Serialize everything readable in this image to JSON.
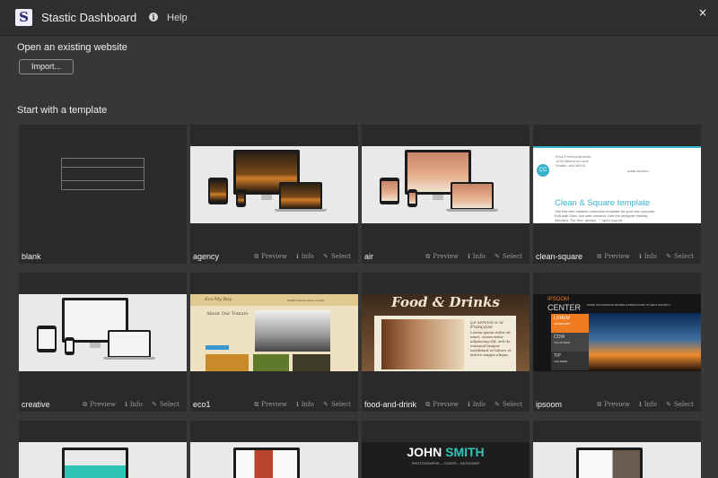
{
  "header": {
    "logo_letter": "S",
    "title": "Stastic Dashboard",
    "help_label": "Help",
    "close_glyph": "×"
  },
  "open_section": {
    "title": "Open an existing website",
    "import_label": "Import..."
  },
  "template_section": {
    "title": "Start with a template"
  },
  "actions": {
    "preview": "Preview",
    "info": "Info",
    "select": "Select"
  },
  "templates": [
    {
      "name": "blank"
    },
    {
      "name": "agency"
    },
    {
      "name": "air"
    },
    {
      "name": "clean-square"
    },
    {
      "name": "creative"
    },
    {
      "name": "eco1"
    },
    {
      "name": "food-and-drink"
    },
    {
      "name": "ipsoom"
    }
  ],
  "thumb_text": {
    "clean_square": {
      "logo": "CC",
      "name_line1": "Erick Ferreira Almeida",
      "name_line2": "1234 Millenium Lane",
      "name_line3": "Seattle, WA 98104",
      "nav": "HOME        CONTACT",
      "title": "Clean & Square template",
      "text_line1": "Use this free creative commons template for your own purpose.",
      "text_line2": "Edit with Silex, live web creation. Use the designer friendly",
      "text_line3": "interface. For free, always, ♡ open source."
    },
    "eco1": {
      "logo": "Eco My Boy",
      "nav": "HOME   Products   About   Contact",
      "subtitle": "About Our Tomato"
    },
    "food": {
      "title": "Food & Drinks",
      "subtitle": "Le service à la Française",
      "body": "Lorem ipsum dolor sit amet, consectetur adipiscing elit, sed do eiusmod tempor incididunt ut labore et dolore magna aliqua."
    },
    "ipsoom": {
      "logo_line1": "IPSOOM",
      "logo_line2": "CENTER",
      "nav": "HOME    OUR MISSION    MOVIES & PRESS    HOW TO HELP    CONTACT",
      "menu1_a": "LOREM",
      "menu1_b": "SOMETHING",
      "menu2_a": "COW",
      "menu2_b": "VOLUNTEER",
      "menu3_a": "TIP",
      "menu3_b": "CHILDREN"
    },
    "john_smith": {
      "first": "JOHN",
      "last": "SMITH",
      "sub": "PHOTOGRAPHE – CODER – DESIGNER"
    }
  },
  "colors": {
    "background": "#373737",
    "topbar": "#2f2f2f",
    "card": "#2a2a2a",
    "accent_teal": "#3ab1cc",
    "accent_orange": "#f07c22"
  }
}
